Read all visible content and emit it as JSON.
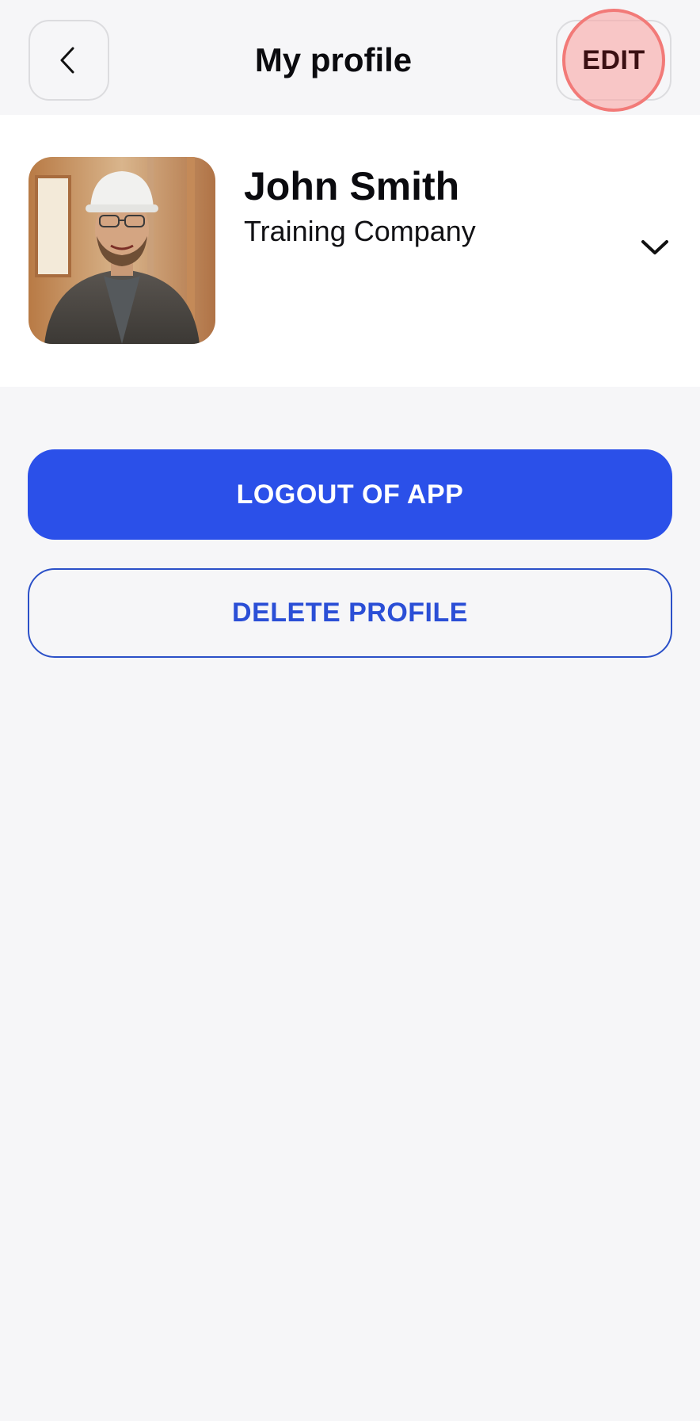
{
  "header": {
    "title": "My profile",
    "back_icon": "chevron-left-icon",
    "edit_label": "EDIT"
  },
  "profile": {
    "name": "John Smith",
    "company": "Training Company",
    "avatar_alt": "Profile photo of man in white hard hat",
    "expand_icon": "chevron-down-icon"
  },
  "actions": {
    "logout_label": "LOGOUT OF APP",
    "delete_label": "DELETE PROFILE"
  },
  "colors": {
    "background": "#f6f6f8",
    "primary": "#2b50e9",
    "highlight": "#f27a78"
  }
}
